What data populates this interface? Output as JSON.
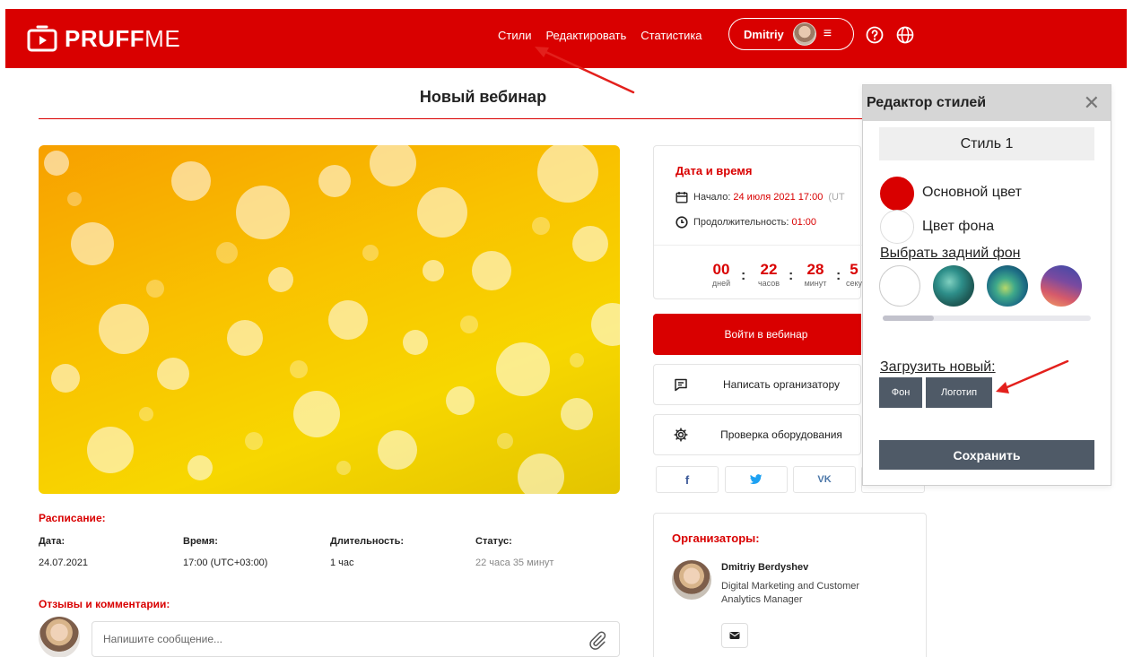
{
  "colors": {
    "brand": "#d90000",
    "editor_button": "#4f5a67",
    "main_color_swatch": "#d90000",
    "bg_color_swatch": "#ffffff"
  },
  "header": {
    "logo_bold": "PRUFF",
    "logo_light": "ME",
    "nav": [
      "Стили",
      "Редактировать",
      "Статистика"
    ],
    "user_name": "Dmitriy",
    "help_icon": "question-circle-icon",
    "language_icon": "globe-icon"
  },
  "page_title": "Новый вебинар",
  "date_card": {
    "title": "Дата и время",
    "start_label": "Начало:",
    "start_value": "24 июля 2021 17:00",
    "start_tz": "(UT",
    "duration_label": "Продолжительность:",
    "duration_value": "01:00",
    "countdown": [
      {
        "value": "00",
        "unit": "дней"
      },
      {
        "value": "22",
        "unit": "часов"
      },
      {
        "value": "28",
        "unit": "минут"
      },
      {
        "value": "5",
        "unit": "секу"
      }
    ]
  },
  "actions": {
    "enter": "Войти в вебинар",
    "write": "Написать организатору",
    "check": "Проверка оборудования"
  },
  "share": [
    "f",
    "t",
    "VK"
  ],
  "schedule": {
    "title": "Расписание:",
    "headers": [
      "Дата:",
      "Время:",
      "Длительность:",
      "Статус:"
    ],
    "values": [
      "24.07.2021",
      "17:00 (UTC+03:00)",
      "1 час",
      "22 часа 35 минут"
    ]
  },
  "comments": {
    "title": "Отзывы и комментарии:",
    "placeholder": "Напишите сообщение..."
  },
  "organizers": {
    "title": "Организаторы:",
    "name": "Dmitriy Berdyshev",
    "role": "Digital Marketing and Customer Analytics Manager"
  },
  "style_editor": {
    "title": "Редактор стилей",
    "close": "✕",
    "style_name": "Стиль 1",
    "main_color_label": "Основной цвет",
    "bg_color_label": "Цвет фона",
    "choose_bg_label": "Выбрать задний фон",
    "backgrounds": [
      "white",
      "teal-forest",
      "teal-blur",
      "purple-orange"
    ],
    "background_scroll_position": 0.25,
    "upload_label": "Загрузить новый:",
    "upload_bg": "Фон",
    "upload_logo": "Логотип",
    "save": "Сохранить"
  }
}
